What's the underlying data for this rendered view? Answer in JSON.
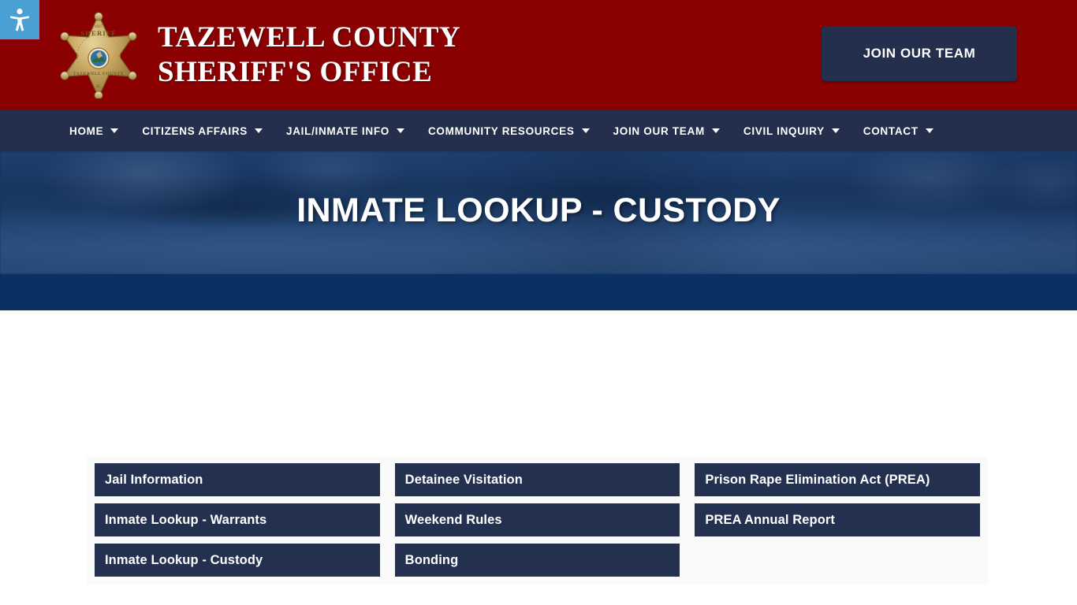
{
  "accessibility": {
    "icon": "accessibility-person-icon",
    "color": "#4a9fd4"
  },
  "header": {
    "background_color": "#8b0000",
    "logo": {
      "icon": "sheriff-star-badge-icon",
      "top_text": "SHERIFF",
      "bottom_text": "TAZEWELL COUNTY",
      "year_text": "1827",
      "state_text": "IL"
    },
    "title": "TAZEWELL COUNTY\nSHERIFF'S OFFICE",
    "cta_label": "JOIN OUR TEAM",
    "cta_color": "#232f4d"
  },
  "nav": {
    "background_color": "#232f4d",
    "items": [
      {
        "label": "HOME",
        "has_dropdown": true
      },
      {
        "label": "CITIZENS AFFAIRS",
        "has_dropdown": true
      },
      {
        "label": "JAIL/INMATE INFO",
        "has_dropdown": true
      },
      {
        "label": "COMMUNITY RESOURCES",
        "has_dropdown": true
      },
      {
        "label": "JOIN OUR TEAM",
        "has_dropdown": true
      },
      {
        "label": "CIVIL INQUIRY",
        "has_dropdown": true
      },
      {
        "label": "CONTACT",
        "has_dropdown": true
      }
    ]
  },
  "hero": {
    "title": "INMATE LOOKUP - CUSTODY",
    "strip_color": "#0b3063"
  },
  "links_panel": {
    "panel_color": "#fafafa",
    "button_color": "#24304f",
    "columns": [
      {
        "items": [
          {
            "label": "Jail Information"
          },
          {
            "label": "Inmate Lookup - Warrants"
          },
          {
            "label": "Inmate Lookup - Custody"
          }
        ]
      },
      {
        "items": [
          {
            "label": "Detainee Visitation"
          },
          {
            "label": "Weekend Rules"
          },
          {
            "label": "Bonding"
          }
        ]
      },
      {
        "items": [
          {
            "label": "Prison Rape Elimination Act (PREA)"
          },
          {
            "label": "PREA Annual Report"
          }
        ]
      }
    ]
  }
}
